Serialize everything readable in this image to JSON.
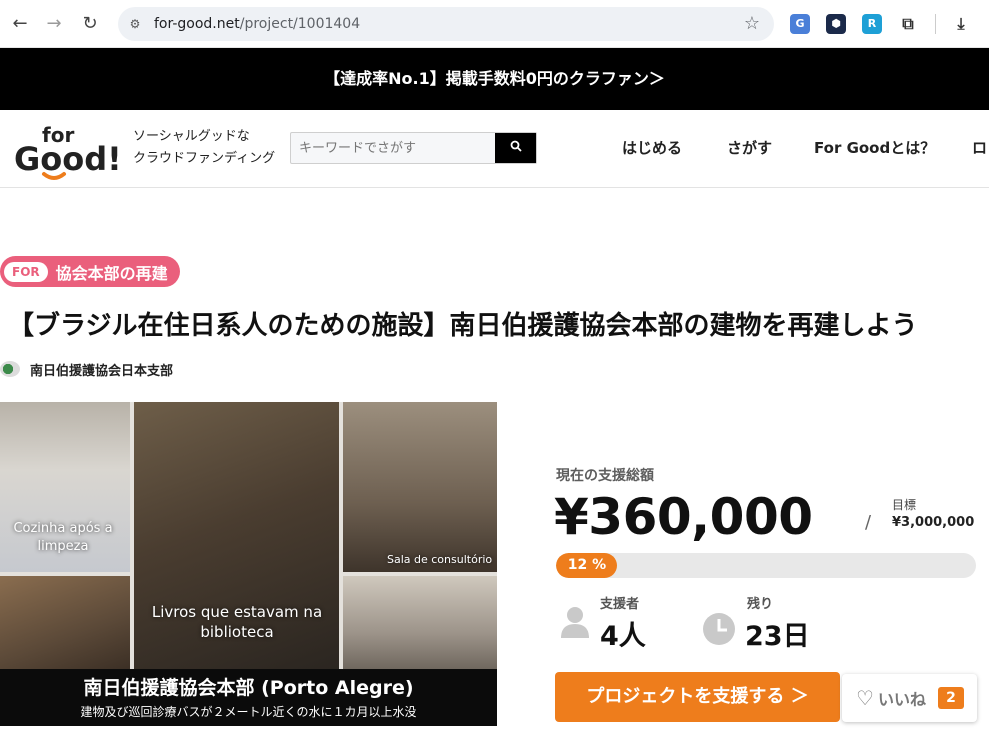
{
  "browser": {
    "url_host": "for-good.net",
    "url_path": "/project/1001404",
    "colors": {
      "omnibox": "#eef1f5"
    }
  },
  "promo": {
    "text": "【達成率No.1】掲載手数料0円のクラファン＞"
  },
  "header": {
    "logo_text": "for Good!",
    "tagline_line1": "ソーシャルグッドな",
    "tagline_line2": "クラウドファンディング",
    "search_placeholder": "キーワードでさがす",
    "nav": [
      "はじめる",
      "さがす",
      "For Goodとは？",
      "ロ"
    ]
  },
  "project": {
    "for_pill": "FOR",
    "for_label": "協会本部の再建",
    "title": "【ブラジル在住日系人のための施設】南日伯援護協会本部の建物を再建しよう",
    "org_name": "南日伯援護協会日本支部",
    "image": {
      "cap_kitchen": "Cozinha após a limpeza",
      "cap_library": "Livros que estavam na biblioteca",
      "cap_consult": "Sala de consultório",
      "band_title": "南日伯援護協会本部 (Porto Alegre)",
      "band_sub": "建物及び巡回診療バスが２メートル近くの水に１カ月以上水没"
    }
  },
  "funding": {
    "total_label": "現在の支援総額",
    "total_amount": "¥360,000",
    "slash": "/",
    "goal_label": "目標",
    "goal_amount": "¥3,000,000",
    "progress_text": "12 %",
    "progress_percent": 12,
    "supporters_label": "支援者",
    "supporters_value": "4人",
    "remaining_label": "残り",
    "remaining_value": "23日",
    "support_button": "プロジェクトを支援する ＞",
    "like_label": "いいね",
    "like_count": "2",
    "colors": {
      "accent": "#ee7d1c",
      "for_tag": "#ea5f7c"
    }
  }
}
